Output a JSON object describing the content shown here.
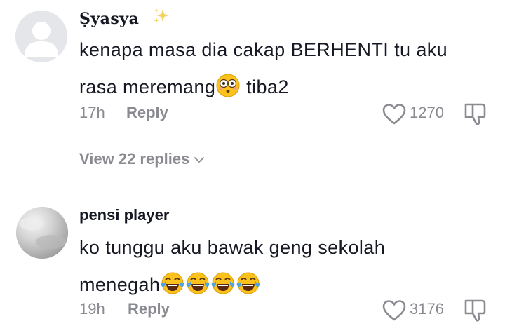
{
  "comments": [
    {
      "username": "Ṣyasya",
      "text_line1": "kenapa masa dia cakap BERHENTI tu aku",
      "text_line2_before": "rasa meremang",
      "text_line2_after": " tiba2",
      "time": "17h",
      "reply_label": "Reply",
      "likes": "1270",
      "view_replies": "View 22 replies"
    },
    {
      "username": "pensi player",
      "text_line1": "ko tunggu aku bawak geng sekolah",
      "text_line2_before": "menegah",
      "time": "19h",
      "reply_label": "Reply",
      "likes": "3176"
    }
  ],
  "icons": [
    "sparkles-icon",
    "flushed-face-emoji",
    "tears-of-joy-emoji",
    "heart-outline-icon",
    "thumbs-down-icon",
    "chevron-down-icon"
  ],
  "colors": {
    "primary_text": "#161823",
    "secondary_text": "#8a8b91",
    "avatar_bg": "#e5e6ea"
  }
}
